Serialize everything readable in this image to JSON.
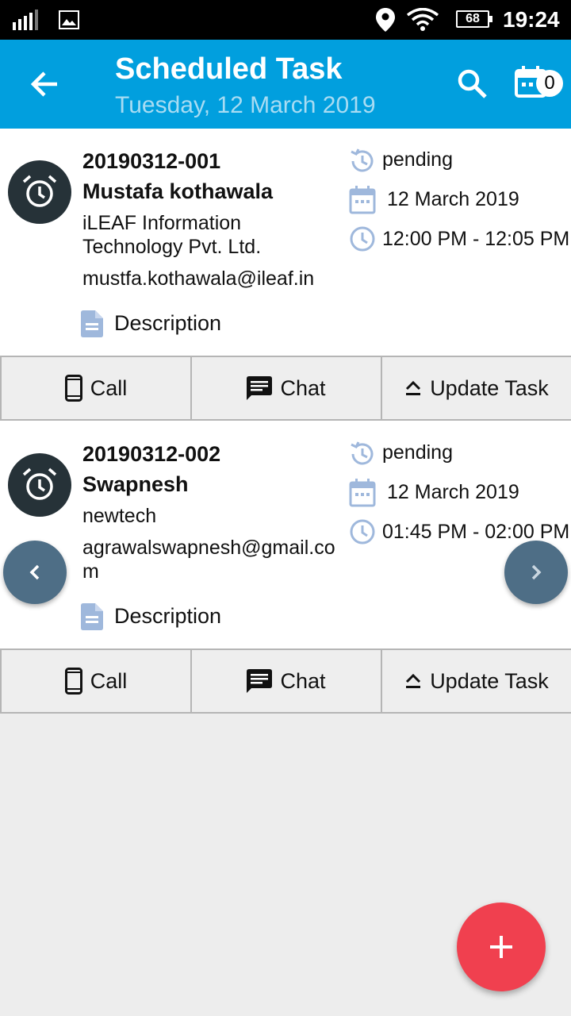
{
  "status_bar": {
    "battery": "68",
    "time": "19:24"
  },
  "app_bar": {
    "title": "Scheduled Task",
    "subtitle": "Tuesday, 12 March 2019",
    "badge_count": "0"
  },
  "tasks": [
    {
      "id": "20190312-001",
      "name": "Mustafa kothawala",
      "company": "iLEAF Information Technology Pvt. Ltd.",
      "email": "mustfa.kothawala@ileaf.in",
      "description_label": "Description",
      "status": "pending",
      "date": "12 March 2019",
      "time": "12:00 PM - 12:05 PM",
      "actions": {
        "call": "Call",
        "chat": "Chat",
        "update": "Update Task"
      }
    },
    {
      "id": "20190312-002",
      "name": "Swapnesh",
      "company": "newtech",
      "email": "agrawalswapnesh@gmail.com",
      "description_label": "Description",
      "status": "pending",
      "date": "12 March 2019",
      "time": "01:45 PM - 02:00 PM",
      "actions": {
        "call": "Call",
        "chat": "Chat",
        "update": "Update Task"
      }
    }
  ],
  "icons": {
    "signal": "signal-icon",
    "image": "image-icon",
    "location": "location-icon",
    "wifi": "wifi-icon",
    "battery": "battery-icon",
    "back": "arrow-back-icon",
    "search": "search-icon",
    "calendar": "calendar-icon",
    "alarm": "alarm-icon",
    "description": "document-icon",
    "status": "history-icon",
    "date": "calendar-icon",
    "time": "clock-icon",
    "call": "phone-icon",
    "chat": "chat-icon",
    "update": "eject-icon",
    "prev": "chevron-left-icon",
    "next": "chevron-right-icon",
    "add": "plus-icon"
  },
  "colors": {
    "app_bar": "#019fde",
    "subtitle": "#a8dcf3",
    "avatar": "#263238",
    "meta_icon": "#9fb8dc",
    "nav_button": "#4e6e86",
    "fab": "#f0404f"
  }
}
